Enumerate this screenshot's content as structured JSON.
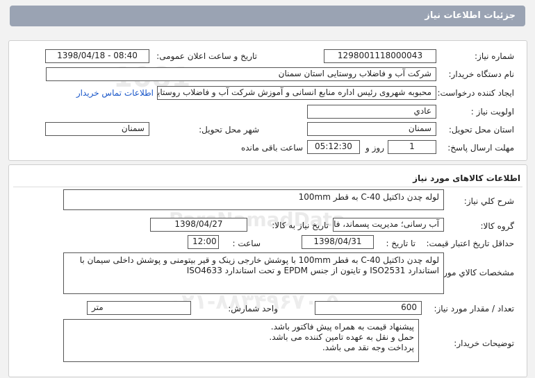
{
  "header": {
    "title": "جزئیات اطلاعات نیاز"
  },
  "info": {
    "need_number_label": "شماره نیاز:",
    "need_number": "1298001118000043",
    "announce_label": "تاریخ و ساعت اعلان عمومی:",
    "announce_value": "1398/04/18 - 08:40",
    "buyer_label": "نام دستگاه خریدار:",
    "buyer_value": "شرکت آب و فاضلاب روستایی استان سمنان",
    "creator_label": "ایجاد کننده درخواست:",
    "creator_value": "محبوبه شهروی رئیس اداره منابع انسانی و آموزش شرکت آب و فاضلاب روستایی",
    "contact_link": "اطلاعات تماس خریدار",
    "priority_label": "اولویت نیاز :",
    "priority_value": "عادي",
    "province_label": "استان محل تحویل:",
    "province_value": "سمنان",
    "city_label": "شهر محل تحویل:",
    "city_value": "سمنان",
    "deadline_label": "مهلت ارسال پاسخ:",
    "deadline_days": "1",
    "day_and": "روز و",
    "deadline_time": "05:12:30",
    "remaining": "ساعت باقی مانده"
  },
  "goods": {
    "section_title": "اطلاعات کالاهای مورد نیاز",
    "general_desc_label": "شرح کلي نياز:",
    "general_desc_value": "لوله چدن داکتیل C-40 به قطر 100mm",
    "group_label": "گروه کالا:",
    "group_value": "آب رسانی؛ مدیریت پسماند، فاضلاب و فعالیت های",
    "need_date_label": "تاریخ نیاز به کالا:",
    "need_date_value": "1398/04/27",
    "min_price_label": "حداقل تاریخ اعتبار قیمت:",
    "until_date_label": "تا تاریخ :",
    "until_date_value": "1398/04/31",
    "time_label": "ساعت :",
    "time_value": "12:00",
    "spec_label": "مشخصات كالاي مورد نياز:",
    "spec_value": "لوله چدن داکتیل C-40 به قطر 100mm با پوشش خارجی زینک و قیر بیتومنی و پوشش داخلی سیمان با استاندارد ISO2531 و تایتون از جنس EPDM و تحت استاندارد ISO4633",
    "qty_label": "تعداد / مقدار مورد نیاز:",
    "qty_value": "600",
    "unit_label": "واحد شمارش:",
    "unit_value": "متر",
    "notes_label": "توضیحات خریدار:",
    "notes_lines": [
      "پیشنهاد قیمت به همراه پیش فاکتور باشد.",
      "حمل و نقل به عهده تامین کننده می باشد.",
      "پرداخت وجه نقد می باشد."
    ]
  },
  "watermark": {
    "brand": "ParsNamadData",
    "phone": "۰۲۱-۸۸۳۴۹۶۷۰-۵"
  }
}
